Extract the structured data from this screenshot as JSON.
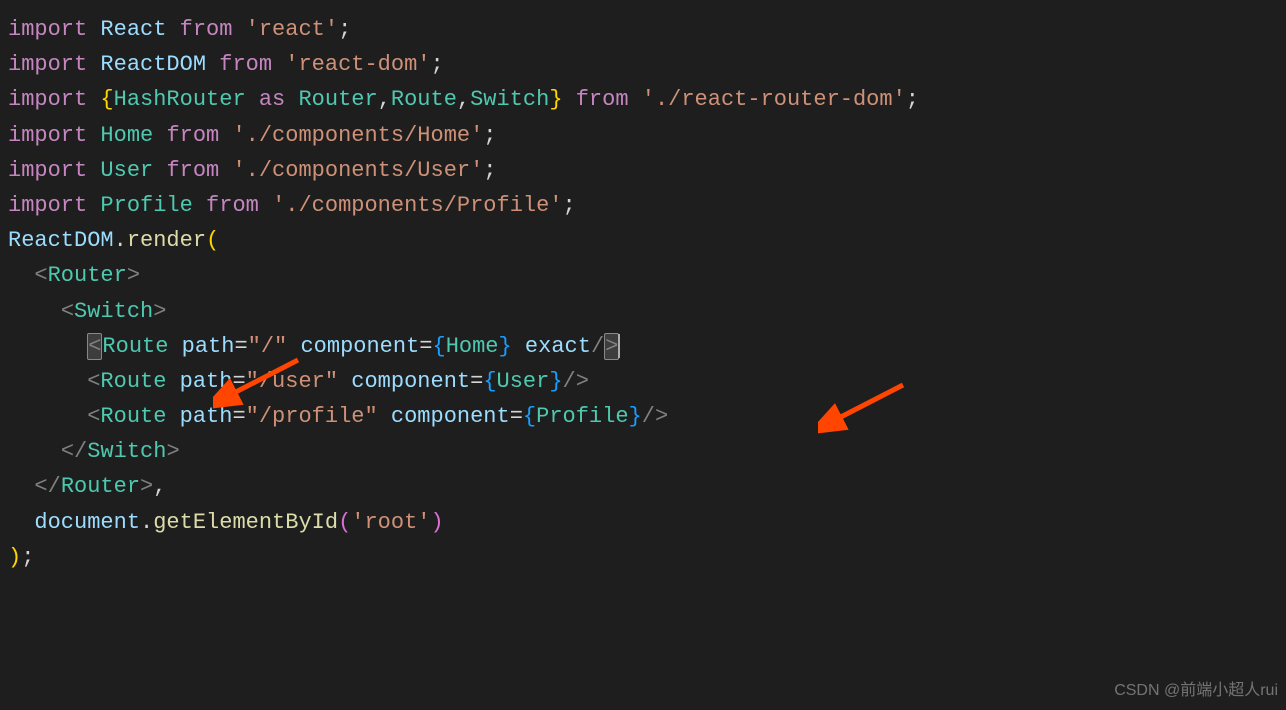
{
  "code": {
    "l1_kw_import": "import",
    "l1_var": "React",
    "l1_kw_from": "from",
    "l1_str": "'react'",
    "l2_kw_import": "import",
    "l2_var": "ReactDOM",
    "l2_kw_from": "from",
    "l2_str": "'react-dom'",
    "l3_kw_import": "import",
    "l3_type1": "HashRouter",
    "l3_kw_as": "as",
    "l3_type2": "Router",
    "l3_type3": "Route",
    "l3_type4": "Switch",
    "l3_kw_from": "from",
    "l3_str": "'./react-router-dom'",
    "l4_kw_import": "import",
    "l4_type": "Home",
    "l4_kw_from": "from",
    "l4_str": "'./components/Home'",
    "l5_kw_import": "import",
    "l5_type": "User",
    "l5_kw_from": "from",
    "l5_str": "'./components/User'",
    "l6_kw_import": "import",
    "l6_type": "Profile",
    "l6_kw_from": "from",
    "l6_str": "'./components/Profile'",
    "l7_var": "ReactDOM",
    "l7_func": "render",
    "l8_type": "Router",
    "l9_type": "Switch",
    "l10_type": "Route",
    "l10_attr1": "path",
    "l10_val1": "\"/\"",
    "l10_attr2": "component",
    "l10_type2": "Home",
    "l10_attr3": "exact",
    "l11_type": "Route",
    "l11_attr1": "path",
    "l11_val1": "\"/user\"",
    "l11_attr2": "component",
    "l11_type2": "User",
    "l12_type": "Route",
    "l12_attr1": "path",
    "l12_val1": "\"/profile\"",
    "l12_attr2": "component",
    "l12_type2": "Profile",
    "l13_type": "Switch",
    "l14_type": "Router",
    "l15_var": "document",
    "l15_func": "getElementById",
    "l15_str": "'root'"
  },
  "watermark": "CSDN @前端小超人rui"
}
